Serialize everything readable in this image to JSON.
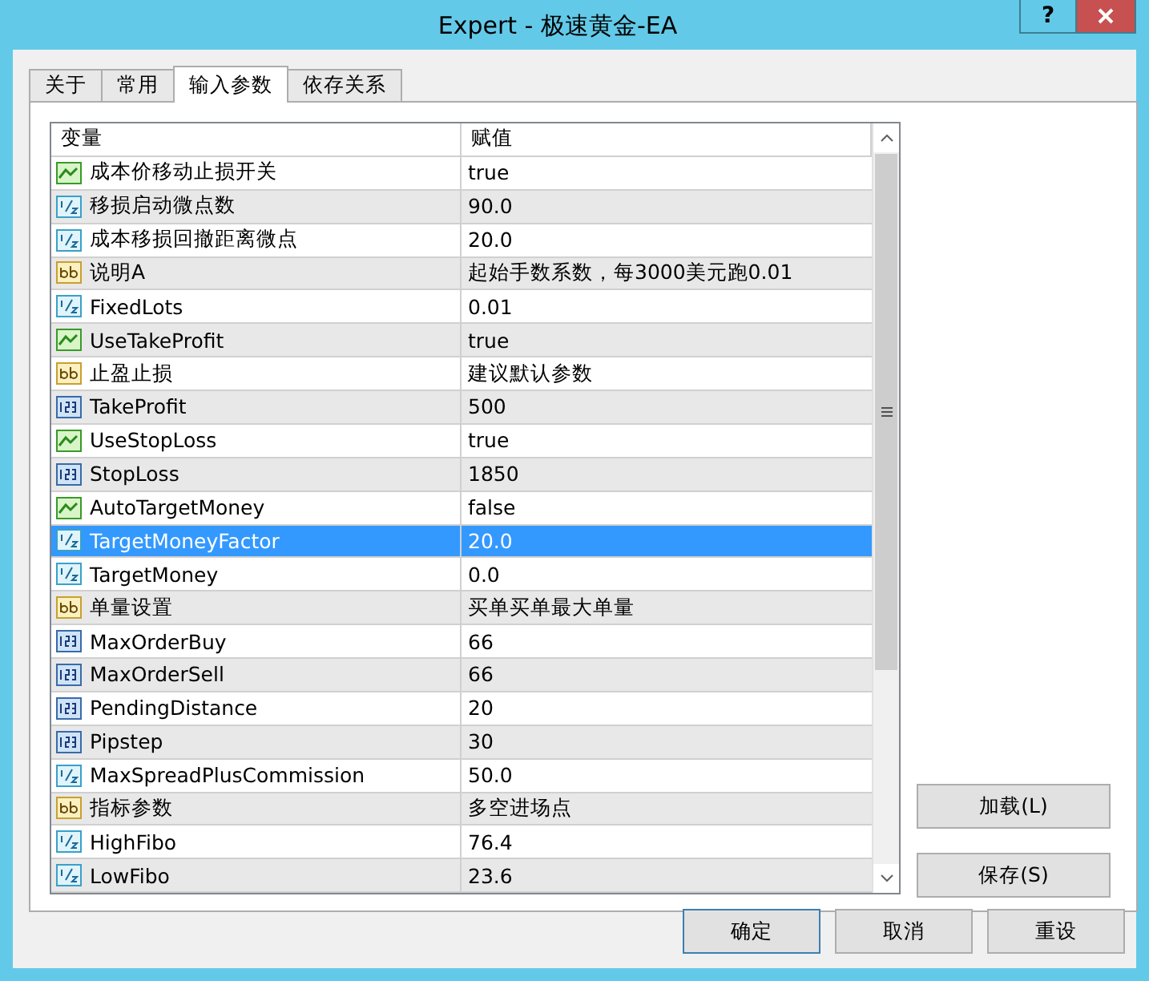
{
  "window": {
    "title": "Expert - 极速黄金-EA",
    "help_button": "?"
  },
  "tabs": [
    {
      "label": "关于",
      "selected": false
    },
    {
      "label": "常用",
      "selected": false
    },
    {
      "label": "输入参数",
      "selected": true
    },
    {
      "label": "依存关系",
      "selected": false
    }
  ],
  "table": {
    "columns": [
      "变量",
      "赋值"
    ],
    "rows": [
      {
        "kind": "bool",
        "name": "成本价移动止损开关",
        "value": "true",
        "selected": false
      },
      {
        "kind": "double",
        "name": "移损启动微点数",
        "value": "90.0",
        "selected": false
      },
      {
        "kind": "double",
        "name": "成本移损回撤距离微点",
        "value": "20.0",
        "selected": false
      },
      {
        "kind": "string",
        "name": "说明A",
        "value": "起始手数系数，每3000美元跑0.01",
        "selected": false
      },
      {
        "kind": "double",
        "name": "FixedLots",
        "value": "0.01",
        "selected": false
      },
      {
        "kind": "bool",
        "name": "UseTakeProfit",
        "value": "true",
        "selected": false
      },
      {
        "kind": "string",
        "name": "止盈止损",
        "value": "建议默认参数",
        "selected": false
      },
      {
        "kind": "int",
        "name": "TakeProfit",
        "value": "500",
        "selected": false
      },
      {
        "kind": "bool",
        "name": "UseStopLoss",
        "value": "true",
        "selected": false
      },
      {
        "kind": "int",
        "name": "StopLoss",
        "value": "1850",
        "selected": false
      },
      {
        "kind": "bool",
        "name": "AutoTargetMoney",
        "value": "false",
        "selected": false
      },
      {
        "kind": "double",
        "name": "TargetMoneyFactor",
        "value": "20.0",
        "selected": true
      },
      {
        "kind": "double",
        "name": "TargetMoney",
        "value": "0.0",
        "selected": false
      },
      {
        "kind": "string",
        "name": "单量设置",
        "value": "买单买单最大单量",
        "selected": false
      },
      {
        "kind": "int",
        "name": "MaxOrderBuy",
        "value": "66",
        "selected": false
      },
      {
        "kind": "int",
        "name": "MaxOrderSell",
        "value": "66",
        "selected": false
      },
      {
        "kind": "int",
        "name": "PendingDistance",
        "value": "20",
        "selected": false
      },
      {
        "kind": "int",
        "name": "Pipstep",
        "value": "30",
        "selected": false
      },
      {
        "kind": "double",
        "name": "MaxSpreadPlusCommission",
        "value": "50.0",
        "selected": false
      },
      {
        "kind": "string",
        "name": "指标参数",
        "value": "多空进场点",
        "selected": false
      },
      {
        "kind": "double",
        "name": "HighFibo",
        "value": "76.4",
        "selected": false
      },
      {
        "kind": "double",
        "name": "LowFibo",
        "value": "23.6",
        "selected": false
      }
    ]
  },
  "side_buttons": [
    "加载(L)",
    "保存(S)"
  ],
  "footer_buttons": [
    {
      "label": "确定",
      "default": true
    },
    {
      "label": "取消",
      "default": false
    },
    {
      "label": "重设",
      "default": false
    }
  ]
}
